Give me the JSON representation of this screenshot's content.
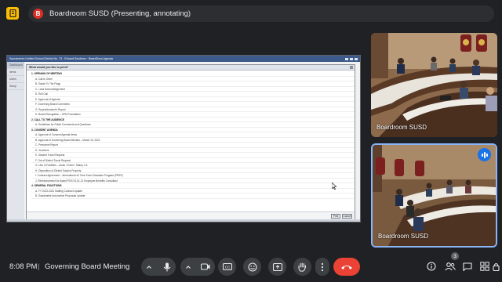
{
  "top_bar": {
    "avatar_initial": "B",
    "presenting_label": "Boardroom SUSD (Presenting, annotating)"
  },
  "shared_screen": {
    "app_title": "Sacramento Unified School District No. 73 - Eboard Solutions · BoardDocs Agenda",
    "nav_items": [
      "Dashboard",
      "Items",
      "Users",
      "Setup"
    ],
    "dialog_title": "What would you like to print?",
    "agenda": [
      {
        "kind": "section",
        "text": "1. OPENING OF MEETING"
      },
      {
        "kind": "item",
        "text": "A. Call to Order"
      },
      {
        "kind": "item",
        "text": "B. Salute To The Flags"
      },
      {
        "kind": "item",
        "text": "C. Land Acknowledgement"
      },
      {
        "kind": "item",
        "text": "D. Roll Call"
      },
      {
        "kind": "item",
        "text": "E. Approval of Agenda"
      },
      {
        "kind": "item",
        "text": "F. Governing Board Comments"
      },
      {
        "kind": "item",
        "text": "G. Superintendent's Report"
      },
      {
        "kind": "item",
        "text": "H. Board Recognition – KPM Foundation"
      },
      {
        "kind": "section",
        "text": "2. CALL TO THE AUDIENCE"
      },
      {
        "kind": "item",
        "text": "A. Guidelines for Public Comments and Questions"
      },
      {
        "kind": "section",
        "text": "3. CONSENT AGENDA"
      },
      {
        "kind": "item",
        "text": "A. Approval of Consent Agenda Items"
      },
      {
        "kind": "item",
        "text": "B. Approval of Governing Board Minutes – March 15, 2022"
      },
      {
        "kind": "item",
        "text": "C. Personnel Report"
      },
      {
        "kind": "item",
        "text": "D. Vouchers"
      },
      {
        "kind": "item",
        "text": "E. Student Travel Request"
      },
      {
        "kind": "item",
        "text": "F. Out of District Travel Request"
      },
      {
        "kind": "item",
        "text": "G. Use of Facilities – Audio / Event / Stamp 1-6"
      },
      {
        "kind": "item",
        "text": "H. Disposition of District Surplus Property"
      },
      {
        "kind": "item",
        "text": "I. Contract Agreement – Amendment #1 Time Zone Education Program (PREP)"
      },
      {
        "kind": "item",
        "text": "J. Reimbursement for Award PDS 03-01-21 Employee Benefits Consultant"
      },
      {
        "kind": "section",
        "text": "4. GENERAL FUNCTIONS"
      },
      {
        "kind": "item",
        "text": "A. FY 2023-2024 Staffing Contract Update"
      },
      {
        "kind": "item",
        "text": "B. Sustainable Automotive Proposals Update"
      }
    ],
    "ok_label": "Print",
    "cancel_label": "Cancel"
  },
  "participants": [
    {
      "name": "Boardroom SUSD",
      "speaking": false
    },
    {
      "name": "Boardroom SUSD",
      "speaking": true
    }
  ],
  "bottom_bar": {
    "time": "8:08 PM",
    "separator": "|",
    "meeting_title": "Governing Board Meeting",
    "people_count": "3"
  },
  "colors": {
    "background": "#202124",
    "control": "#3c4043",
    "leave": "#ea4335",
    "accent": "#8ab4f8",
    "notes": "#fbbc04"
  },
  "icons": [
    "notes-icon",
    "chevron-up-icon",
    "mic-icon",
    "camera-icon",
    "captions-icon",
    "emoji-icon",
    "present-icon",
    "raise-hand-icon",
    "more-vert-icon",
    "call-end-icon",
    "info-icon",
    "people-icon",
    "chat-icon",
    "activities-icon",
    "lock-icon",
    "speaking-icon"
  ]
}
